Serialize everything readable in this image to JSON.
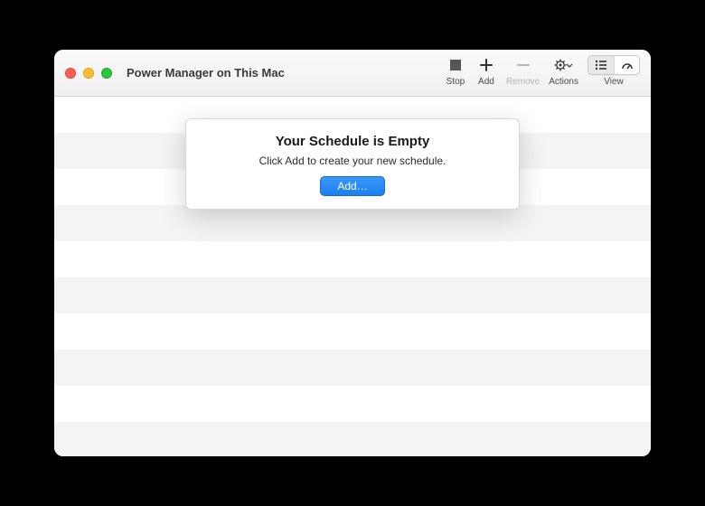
{
  "window": {
    "title": "Power Manager on This Mac"
  },
  "toolbar": {
    "stop": "Stop",
    "add": "Add",
    "remove": "Remove",
    "actions": "Actions",
    "view": "View"
  },
  "sheet": {
    "title": "Your Schedule is Empty",
    "message": "Click Add to create your new schedule.",
    "button": "Add…"
  },
  "colors": {
    "accent": "#1a7ff0"
  }
}
